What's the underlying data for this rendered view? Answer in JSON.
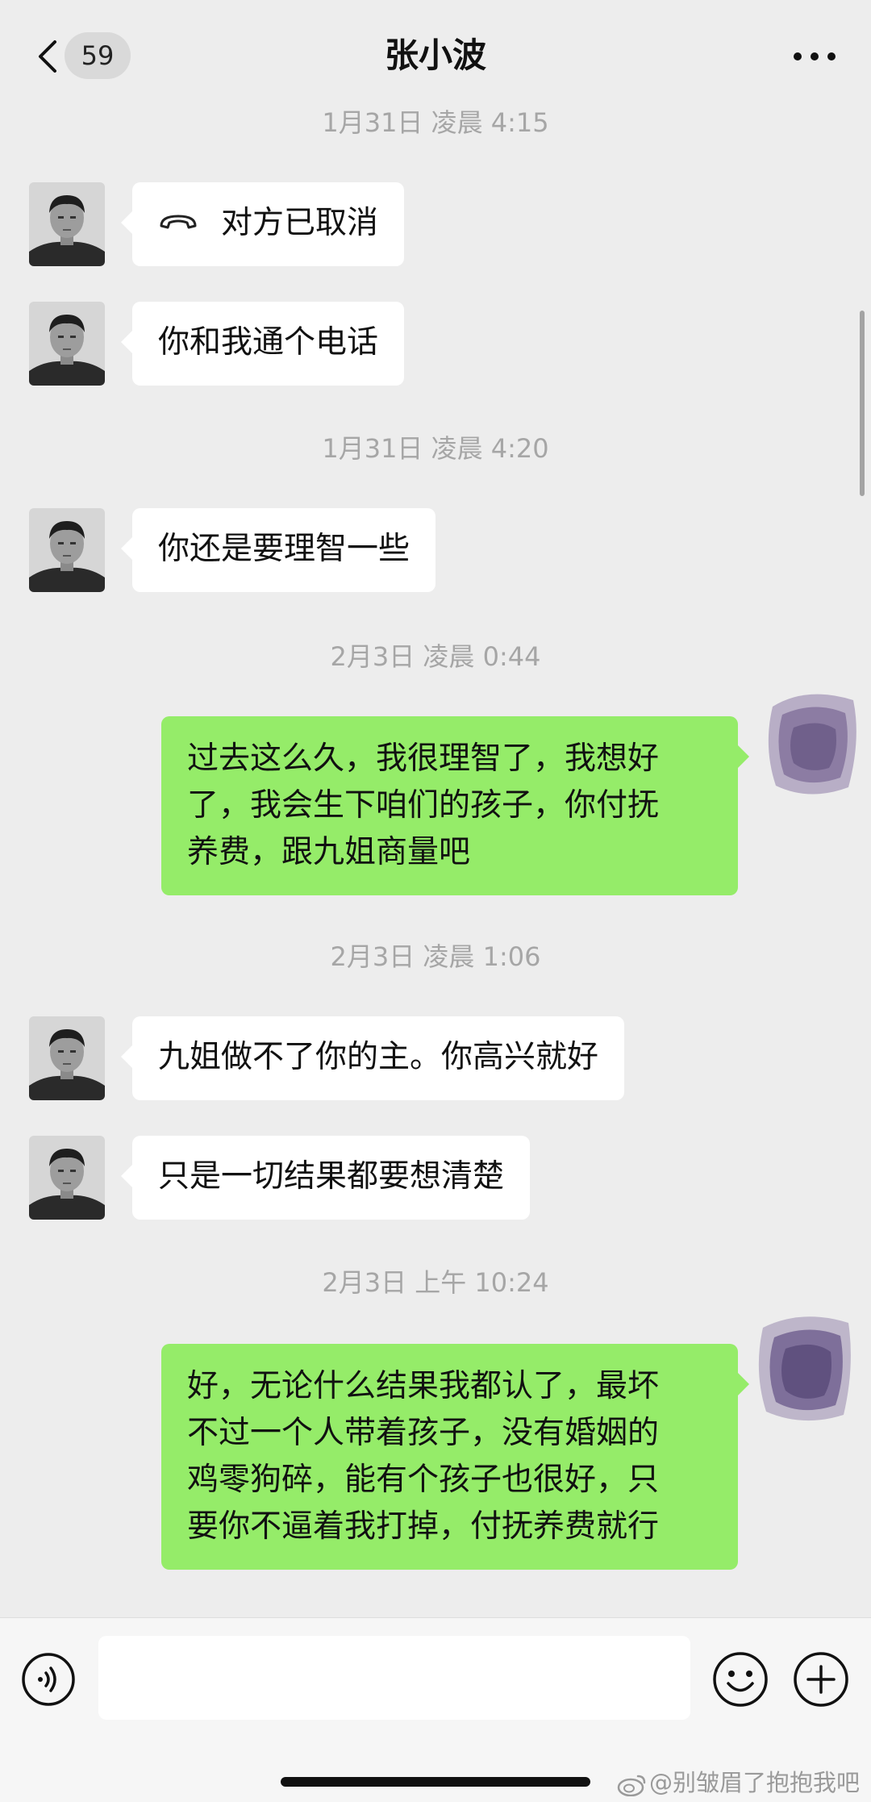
{
  "header": {
    "unread_count": "59",
    "title": "张小波",
    "back_icon": "chevron-left-icon",
    "more_icon": "more-dots-icon"
  },
  "messages": [
    {
      "type": "timestamp",
      "text": "1月31日 凌晨 4:15"
    },
    {
      "type": "incoming",
      "kind": "call",
      "icon": "phone-hangup-icon",
      "text": "对方已取消"
    },
    {
      "type": "incoming",
      "text": "你和我通个电话"
    },
    {
      "type": "timestamp",
      "text": "1月31日 凌晨 4:20"
    },
    {
      "type": "incoming",
      "text": "你还是要理智一些"
    },
    {
      "type": "timestamp",
      "text": "2月3日 凌晨 0:44"
    },
    {
      "type": "outgoing",
      "lines": [
        "过去这么久，我很理智了，我想好",
        "了，我会生下咱们的孩子，你付抚",
        "养费，跟九姐商量吧"
      ]
    },
    {
      "type": "timestamp",
      "text": "2月3日 凌晨 1:06"
    },
    {
      "type": "incoming",
      "text": "九姐做不了你的主。你高兴就好"
    },
    {
      "type": "incoming",
      "text": "只是一切结果都要想清楚"
    },
    {
      "type": "timestamp",
      "text": "2月3日 上午 10:24"
    },
    {
      "type": "outgoing",
      "lines": [
        "好，无论什么结果我都认了，最坏",
        "不过一个人带着孩子，没有婚姻的",
        "鸡零狗碎，能有个孩子也很好，只",
        "要你不逼着我打掉，付抚养费就行"
      ]
    }
  ],
  "input_bar": {
    "voice_icon": "voice-icon",
    "input_value": "",
    "emoji_icon": "emoji-icon",
    "plus_icon": "plus-icon"
  },
  "watermark": {
    "text": "@别皱眉了抱抱我吧",
    "icon": "weibo-icon"
  },
  "colors": {
    "background": "#ededed",
    "incoming_bubble": "#ffffff",
    "outgoing_bubble": "#95ec69",
    "timestamp_text": "#a6a6a6"
  }
}
